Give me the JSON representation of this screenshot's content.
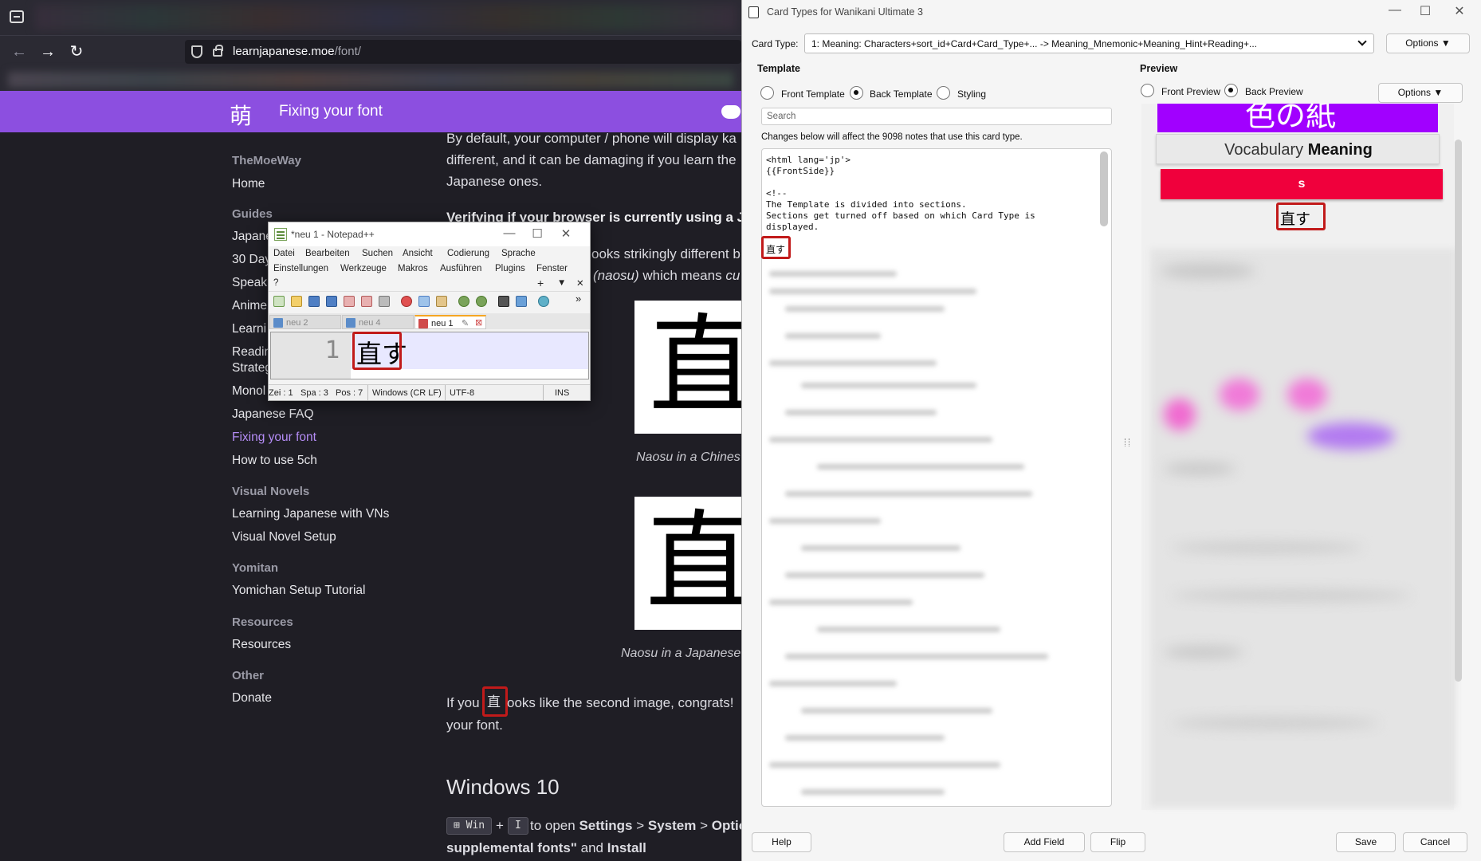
{
  "browser": {
    "url_host": "learnjapanese.moe",
    "url_path": "/font/",
    "site_logo": "萌",
    "site_title": "Fixing your font",
    "sidebar": {
      "sections": [
        {
          "heading": "TheMoeWay",
          "items": [
            "Home"
          ]
        },
        {
          "heading": "Guides",
          "items": [
            "Japane",
            "30 Day",
            "Speaki",
            "Anime",
            "Learni",
            "Readin",
            "Strateg",
            "Monol",
            "Japanese FAQ",
            "Fixing your font",
            "How to use 5ch"
          ]
        },
        {
          "heading": "Visual Novels",
          "items": [
            "Learning Japanese with VNs",
            "Visual Novel Setup"
          ]
        },
        {
          "heading": "Yomitan",
          "items": [
            "Yomichan Setup Tutorial"
          ]
        },
        {
          "heading": "Resources",
          "items": [
            "Resources"
          ]
        },
        {
          "heading": "Other",
          "items": [
            "Donate"
          ]
        }
      ],
      "active_item": "Fixing your font"
    },
    "article": {
      "p1_l1": "By default, your computer / phone will display ka",
      "p1_l2": "different, and it can be damaging if you learn the",
      "p1_l3": "Japanese ones.",
      "verify_heading": "Verifying if your browser is currently using a Jap",
      "p2_l1": "ooks strikingly different b",
      "p2_l2_a": "(naosu)",
      "p2_l2_b": " which means ",
      "p2_l2_c": "cu",
      "kanji": "直",
      "caption1": "Naosu in a Chines",
      "caption2": "Naosu in a Japanese",
      "p3_a": "If you",
      "p3_kanji": "直",
      "p3_b": "ooks like the second image, congrats! ",
      "p3_l2": "your font.",
      "windows_heading": "Windows 10",
      "kbd_win": "⊞ Win",
      "kbd_plus": "+",
      "kbd_i": "I",
      "win_l1_a": "to open ",
      "win_l1_b": "Settings",
      "win_l1_c": " > ",
      "win_l1_d": "System",
      "win_l1_e": " > ",
      "win_l1_f": "Optio",
      "win_l2_a": "supplemental fonts\"",
      "win_l2_b": " and ",
      "win_l2_c": "Install"
    }
  },
  "notepad": {
    "title": "*neu 1 - Notepad++",
    "menu_row1": [
      "Datei",
      "Bearbeiten",
      "Suchen",
      "Ansicht",
      "Codierung",
      "Sprache"
    ],
    "menu_row2": [
      "Einstellungen",
      "Werkzeuge",
      "Makros",
      "Ausführen",
      "Plugins",
      "Fenster"
    ],
    "menu_row3": [
      "?"
    ],
    "tabs": [
      "neu 2",
      "neu 4",
      "neu 1"
    ],
    "active_tab": "neu 1",
    "line_number": "1",
    "content": "直す",
    "status": {
      "line": "Zei : 1",
      "col": "Spa : 3",
      "pos": "Pos : 7",
      "eol": "Windows (CR LF)",
      "encoding": "UTF-8",
      "mode": "INS"
    }
  },
  "dialog": {
    "title": "Card Types for Wanikani Ultimate 3",
    "card_type_label": "Card Type:",
    "card_type_value": "1: Meaning: Characters+sort_id+Card+Card_Type+... -> Meaning_Mnemonic+Meaning_Hint+Reading+...",
    "options_label": "Options ▼",
    "template_heading": "Template",
    "preview_heading": "Preview",
    "template_radios": [
      "Front Template",
      "Back Template",
      "Styling"
    ],
    "template_selected": "Back Template",
    "preview_radios": [
      "Front Preview",
      "Back Preview"
    ],
    "preview_selected": "Back Preview",
    "preview_options_label": "Options ▼",
    "search_placeholder": "Search",
    "changes_note": "Changes below will affect the 9098 notes that use this card type.",
    "code_lines": [
      "<html lang='jp'>",
      "{{FrontSide}}",
      "",
      "<!--",
      "The Template is divided into sections.",
      "Sections get turned off based on which Card Type is",
      "displayed."
    ],
    "code_cursor_word": "直す",
    "preview": {
      "purple_text": "色の紙",
      "vocab_prefix": "Vocabulary ",
      "vocab_bold": "Meaning",
      "red_text": "s",
      "word": "直す"
    },
    "buttons": {
      "help": "Help",
      "add_field": "Add Field",
      "flip": "Flip",
      "save": "Save",
      "cancel": "Cancel"
    }
  },
  "colors": {
    "site_purple": "#8c4fe0",
    "preview_purple": "#a100ff",
    "preview_red": "#f0003c",
    "highlight_red": "#c11a1a"
  }
}
